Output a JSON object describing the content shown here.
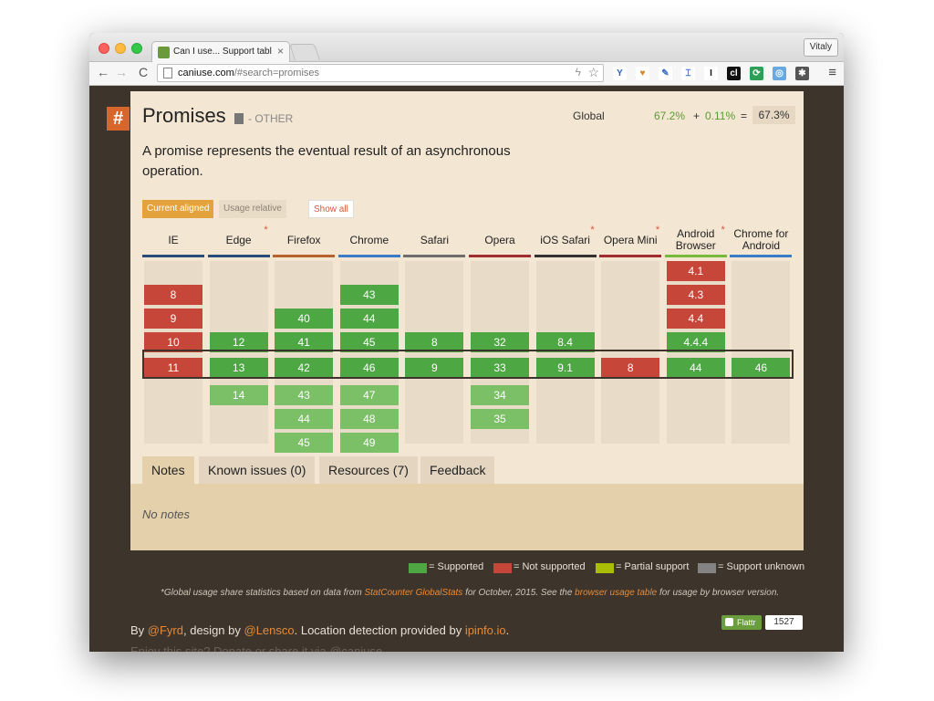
{
  "browser": {
    "tab_title": "Can I use... Support tables",
    "tab_close": "×",
    "user": "Vitaly",
    "url_host": "caniuse.com",
    "url_path": "/#search=promises",
    "icons": [
      "back-icon",
      "forward-icon",
      "reload-icon",
      "star-icon",
      "menu-icon"
    ],
    "back": "←",
    "forward": "→",
    "reload": "C",
    "star": "☆",
    "bolt": "ϟ",
    "menu": "≡",
    "extensions": [
      {
        "glyph": "Y",
        "color": "#2b5fc1",
        "bg": "#ffffff"
      },
      {
        "glyph": "♥",
        "color": "#d08a2a",
        "bg": "#ffffff"
      },
      {
        "glyph": "✎",
        "color": "#3a6fc0",
        "bg": "#ffffff"
      },
      {
        "glyph": "⌶",
        "color": "#3a6fc0",
        "bg": "#ffffff"
      },
      {
        "glyph": "I",
        "color": "#111111",
        "bg": "#ffffff"
      },
      {
        "glyph": "cl",
        "color": "#ffffff",
        "bg": "#111111"
      },
      {
        "glyph": "⟳",
        "color": "#ffffff",
        "bg": "#2f9e57"
      },
      {
        "glyph": "◎",
        "color": "#ffffff",
        "bg": "#6aa9e0"
      },
      {
        "glyph": "✱",
        "color": "#ffffff",
        "bg": "#555555"
      }
    ]
  },
  "feature": {
    "hash": "#",
    "title": "Promises",
    "category": "- OTHER",
    "global_label": "Global",
    "usage_supported": "67.2%",
    "usage_plus": "+",
    "usage_partial": "0.11%",
    "usage_eq": "=",
    "usage_total": "67.3%",
    "description": "A promise represents the eventual result of an asynchronous operation."
  },
  "toggles": {
    "current": "Current aligned",
    "relative": "Usage relative",
    "show_all": "Show all"
  },
  "colors": {
    "supported": "#4da742",
    "not_supported": "#c6473a",
    "partial": "#a8bd04",
    "unknown": "#838383",
    "future": "#7bbf66"
  },
  "browsers": [
    {
      "name": "IE",
      "line": "#2a4c7d",
      "star": false,
      "cells": [
        {
          "v": "8",
          "s": "n",
          "r": 1
        },
        {
          "v": "9",
          "s": "n",
          "r": 2
        },
        {
          "v": "10",
          "s": "n",
          "r": 3
        },
        {
          "v": "11",
          "s": "n",
          "r": 4
        }
      ]
    },
    {
      "name": "Edge",
      "line": "#2a4c7d",
      "star": true,
      "cells": [
        {
          "v": "12",
          "s": "y",
          "r": 3
        },
        {
          "v": "13",
          "s": "y",
          "r": 4
        },
        {
          "v": "14",
          "s": "f",
          "r": 5
        }
      ]
    },
    {
      "name": "Firefox",
      "line": "#b5622c",
      "star": false,
      "cells": [
        {
          "v": "40",
          "s": "y",
          "r": 2
        },
        {
          "v": "41",
          "s": "y",
          "r": 3
        },
        {
          "v": "42",
          "s": "y",
          "r": 4
        },
        {
          "v": "43",
          "s": "f",
          "r": 5
        },
        {
          "v": "44",
          "s": "f",
          "r": 6
        },
        {
          "v": "45",
          "s": "f",
          "r": 7
        }
      ]
    },
    {
      "name": "Chrome",
      "line": "#3a7bc8",
      "star": false,
      "cells": [
        {
          "v": "43",
          "s": "y",
          "r": 1
        },
        {
          "v": "44",
          "s": "y",
          "r": 2
        },
        {
          "v": "45",
          "s": "y",
          "r": 3
        },
        {
          "v": "46",
          "s": "y",
          "r": 4
        },
        {
          "v": "47",
          "s": "f",
          "r": 5
        },
        {
          "v": "48",
          "s": "f",
          "r": 6
        },
        {
          "v": "49",
          "s": "f",
          "r": 7
        }
      ]
    },
    {
      "name": "Safari",
      "line": "#6d6d6d",
      "star": false,
      "cells": [
        {
          "v": "8",
          "s": "y",
          "r": 3
        },
        {
          "v": "9",
          "s": "y",
          "r": 4
        }
      ]
    },
    {
      "name": "Opera",
      "line": "#a12e2e",
      "star": false,
      "cells": [
        {
          "v": "32",
          "s": "y",
          "r": 3
        },
        {
          "v": "33",
          "s": "y",
          "r": 4
        },
        {
          "v": "34",
          "s": "f",
          "r": 5
        },
        {
          "v": "35",
          "s": "f",
          "r": 6
        }
      ]
    },
    {
      "name": "iOS Safari",
      "line": "#333333",
      "star": true,
      "cells": [
        {
          "v": "8.4",
          "s": "y",
          "r": 3
        },
        {
          "v": "9.1",
          "s": "y",
          "r": 4
        }
      ]
    },
    {
      "name": "Opera Mini",
      "line": "#a12e2e",
      "star": true,
      "cells": [
        {
          "v": "8",
          "s": "n",
          "r": 4
        }
      ]
    },
    {
      "name": "Android Browser",
      "line": "#78b83a",
      "star": true,
      "cells": [
        {
          "v": "4.1",
          "s": "n",
          "r": 0
        },
        {
          "v": "4.3",
          "s": "n",
          "r": 1
        },
        {
          "v": "4.4",
          "s": "n",
          "r": 2
        },
        {
          "v": "4.4.4",
          "s": "y",
          "r": 3
        },
        {
          "v": "44",
          "s": "y",
          "r": 4
        }
      ]
    },
    {
      "name": "Chrome for Android",
      "line": "#3a7bc8",
      "star": false,
      "cells": [
        {
          "v": "46",
          "s": "y",
          "r": 4
        }
      ]
    }
  ],
  "tabs": {
    "notes": "Notes",
    "issues": "Known issues (0)",
    "resources": "Resources (7)",
    "feedback": "Feedback"
  },
  "notes_text": "No notes",
  "legend": {
    "supported": "= Supported",
    "not_supported": "= Not supported",
    "partial": "= Partial support",
    "unknown": "= Support unknown"
  },
  "footnote": {
    "before": "*Global usage share statistics based on data from ",
    "link1": "StatCounter GlobalStats",
    "middle": " for October, 2015. See the ",
    "link2": "browser usage table",
    "after": " for usage by browser version."
  },
  "credits": {
    "by": "By ",
    "fyrd": "@Fyrd",
    "design": ", design by ",
    "lensco": "@Lensco",
    "location": ". Location detection provided by ",
    "ipinfo": "ipinfo.io",
    "end": "."
  },
  "flattr": {
    "label": "Flattr",
    "count": "1527"
  },
  "cut_text": "Enjoy this site? Donate or share it via @caniuse"
}
